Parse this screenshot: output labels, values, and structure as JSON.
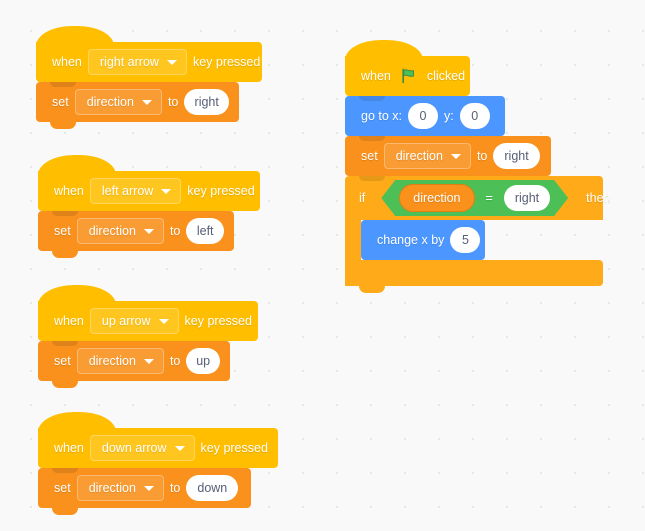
{
  "editor": {
    "name": "scratch-block-workspace",
    "background_color": "#f9f9f9",
    "grid_dot_color": "#e6e6e6"
  },
  "palette": {
    "events_color": "#ffbf00",
    "variables_color": "#f9911c",
    "motion_color": "#4c97ff",
    "control_color": "#ffab19",
    "operators_color": "#4cbf56",
    "text_color": "#ffffff",
    "input_text_color": "#575e75",
    "flag_green": "#4cbf56"
  },
  "scripts": [
    {
      "id": "script-right-arrow",
      "blocks": [
        {
          "type": "hat",
          "name": "when-key-pressed-block",
          "label_before": "when",
          "dropdown_value": "right arrow",
          "label_after": "key pressed"
        },
        {
          "type": "set-variable",
          "name": "set-variable-block",
          "label_before": "set",
          "dropdown_value": "direction",
          "label_mid": "to",
          "input_value": "right"
        }
      ]
    },
    {
      "id": "script-left-arrow",
      "blocks": [
        {
          "type": "hat",
          "name": "when-key-pressed-block",
          "label_before": "when",
          "dropdown_value": "left arrow",
          "label_after": "key pressed"
        },
        {
          "type": "set-variable",
          "name": "set-variable-block",
          "label_before": "set",
          "dropdown_value": "direction",
          "label_mid": "to",
          "input_value": "left"
        }
      ]
    },
    {
      "id": "script-up-arrow",
      "blocks": [
        {
          "type": "hat",
          "name": "when-key-pressed-block",
          "label_before": "when",
          "dropdown_value": "up arrow",
          "label_after": "key pressed"
        },
        {
          "type": "set-variable",
          "name": "set-variable-block",
          "label_before": "set",
          "dropdown_value": "direction",
          "label_mid": "to",
          "input_value": "up"
        }
      ]
    },
    {
      "id": "script-down-arrow",
      "blocks": [
        {
          "type": "hat",
          "name": "when-key-pressed-block",
          "label_before": "when",
          "dropdown_value": "down arrow",
          "label_after": "key pressed"
        },
        {
          "type": "set-variable",
          "name": "set-variable-block",
          "label_before": "set",
          "dropdown_value": "direction",
          "label_mid": "to",
          "input_value": "down"
        }
      ]
    }
  ],
  "main_script": {
    "id": "script-flag-clicked",
    "hat": {
      "label_before": "when",
      "icon": "green-flag-icon",
      "label_after": "clicked"
    },
    "goto": {
      "label_x": "go to x:",
      "x_value": "0",
      "label_y": "y:",
      "y_value": "0"
    },
    "set": {
      "label_before": "set",
      "dropdown_value": "direction",
      "label_mid": "to",
      "input_value": "right"
    },
    "if": {
      "label_if": "if",
      "label_then": "then",
      "condition": {
        "left_reporter": "direction",
        "operator": "=",
        "right_value": "right"
      },
      "body": {
        "label": "change x by",
        "value": "5"
      }
    }
  }
}
